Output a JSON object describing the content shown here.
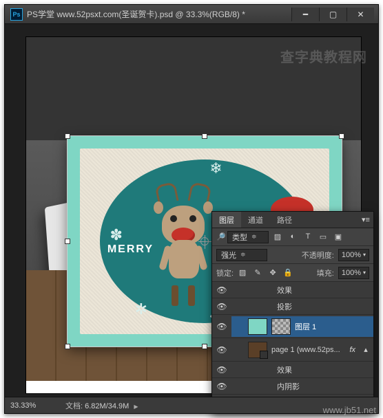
{
  "window": {
    "title": "PS学堂 www.52psxt.com(圣诞贺卡).psd @ 33.3%(RGB/8) *"
  },
  "artwork": {
    "merry_text": "MERRY"
  },
  "panel": {
    "tabs": {
      "layers": "图层",
      "channels": "通道",
      "paths": "路径"
    },
    "kind_label": "类型",
    "blend_mode": "强光",
    "opacity_label": "不透明度:",
    "opacity_value": "100%",
    "lock_label": "锁定:",
    "fill_label": "填充:",
    "fill_value": "100%",
    "layers": {
      "fx": "效果",
      "drop_shadow": "投影",
      "inner_shadow": "内阴影",
      "layer1": "图层 1",
      "page1": "page 1 (www.52ps...",
      "fx_tag": "fx"
    }
  },
  "status": {
    "zoom": "33.33%",
    "doc_label": "文档:",
    "doc_value": "6.82M/34.9M"
  },
  "watermark": {
    "top": "查字典教程网",
    "bottom": "www.jb51.net"
  }
}
